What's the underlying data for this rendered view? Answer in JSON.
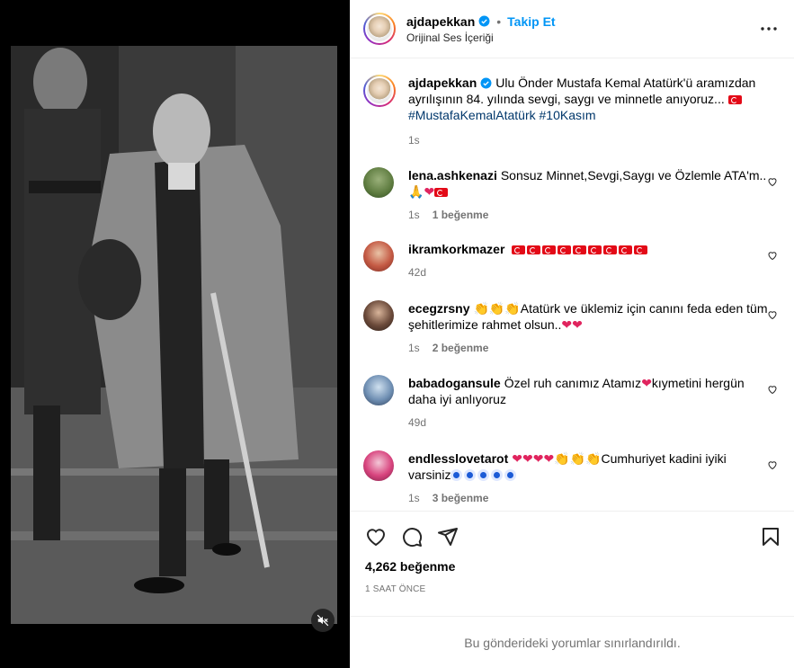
{
  "header": {
    "username": "ajdapekkan",
    "separator": "•",
    "follow_label": "Takip Et",
    "audio_label": "Orijinal Ses İçeriği"
  },
  "caption": {
    "username": "ajdapekkan",
    "text": "Ulu Önder Mustafa Kemal Atatürk'ü aramızdan ayrılışının 84. yılında sevgi, saygı ve minnetle anıyoruz... ",
    "hashtags": "#MustafaKemalAtatürk #10Kasım",
    "time": "1s"
  },
  "comments": [
    {
      "username": "lena.ashkenazi",
      "text": "Sonsuz Minnet,Sevgi,Saygı ve Özlemle ATA'm..",
      "time": "1s",
      "likes": "1 beğenme"
    },
    {
      "username": "ikramkorkmazer",
      "text": "",
      "time": "42d",
      "likes": ""
    },
    {
      "username": "ecegzrsny",
      "text": "Atatürk ve ükle­miz için canını feda eden tüm şehitlerimize rahmet olsun..",
      "time": "1s",
      "likes": "2 beğenme"
    },
    {
      "username": "babadogansule",
      "text": "Özel ruh canımız Atamız",
      "text2": "kıymetini hergün daha iyi anlıyoruz",
      "time": "49d",
      "likes": ""
    },
    {
      "username": "endlesslovetarot",
      "text": "Cumhuriyet kadini iyiki varsiniz",
      "time": "1s",
      "likes": "3 beğenme"
    }
  ],
  "likes_total": "4,262 beğenme",
  "time_ago": "1 SAAT ÖNCE",
  "comments_limited": "Bu gönderideki yorumlar sınırlandırıldı.",
  "colors": {
    "accent": "#0095f6",
    "hashtag": "#00376b",
    "muted": "#737373"
  }
}
